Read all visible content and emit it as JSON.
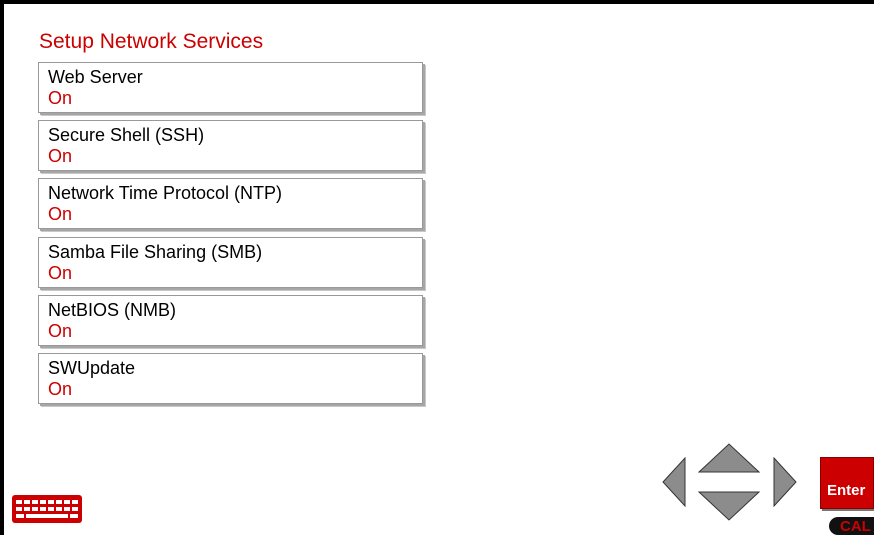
{
  "title": "Setup Network Services",
  "items": [
    {
      "label": "Web Server",
      "value": "On"
    },
    {
      "label": "Secure Shell (SSH)",
      "value": "On"
    },
    {
      "label": "Network Time Protocol (NTP)",
      "value": "On"
    },
    {
      "label": "Samba File Sharing (SMB)",
      "value": "On"
    },
    {
      "label": "NetBIOS (NMB)",
      "value": "On"
    },
    {
      "label": "SWUpdate",
      "value": "On"
    }
  ],
  "controls": {
    "keyboard_icon": "keyboard-icon",
    "nav_icons": [
      "arrow-left-icon",
      "arrow-up-icon",
      "arrow-down-icon",
      "arrow-right-icon"
    ],
    "enter_label": "Enter",
    "cal_label": "CAL"
  },
  "colors": {
    "accent": "#cc0000",
    "nav_arrow": "#8c8c8c",
    "text": "#000000"
  }
}
